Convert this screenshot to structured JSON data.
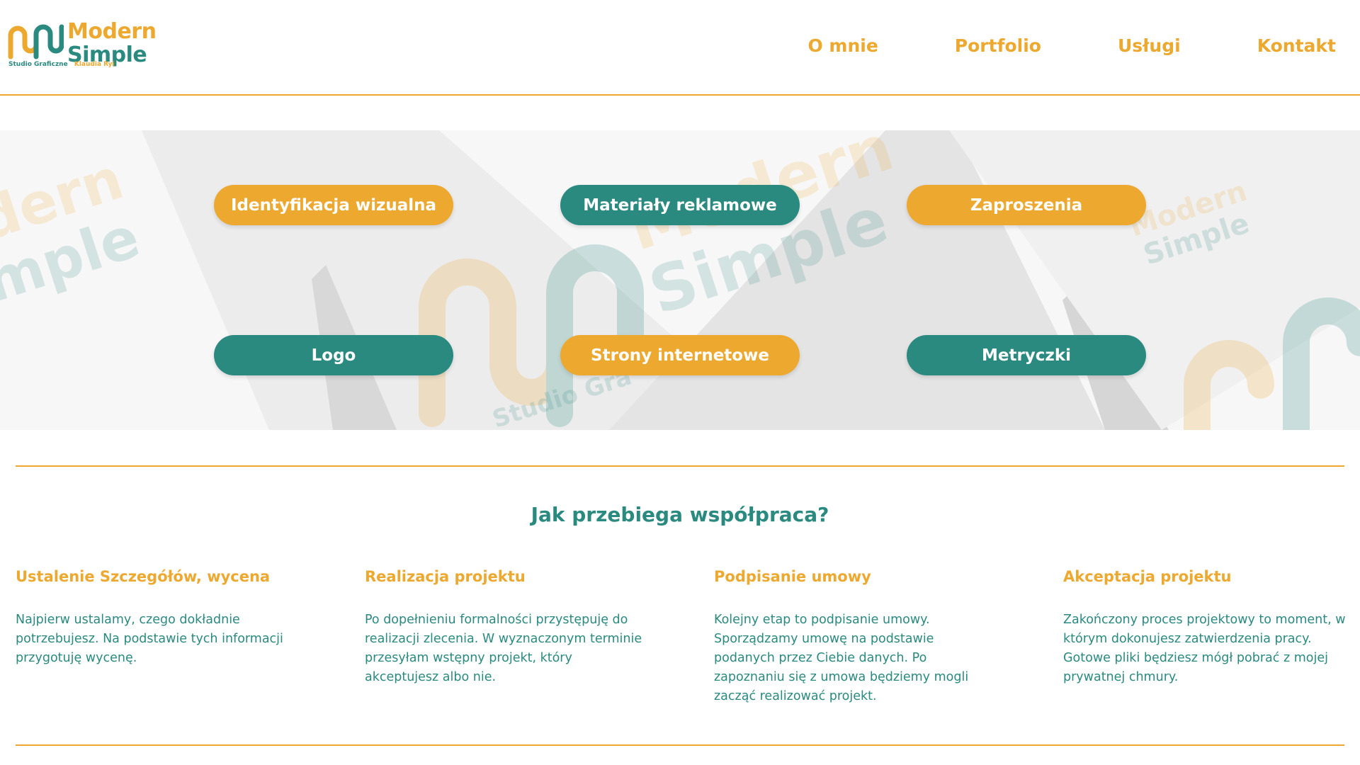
{
  "brand": {
    "name_line1": "Modern",
    "name_line2": "Simple",
    "sub_left": "Studio Graficzne",
    "sub_right": "Klaudia Ryi",
    "orange": "#eca82f",
    "teal": "#2a8a80"
  },
  "nav": {
    "items": [
      {
        "label": "O mnie"
      },
      {
        "label": "Portfolio"
      },
      {
        "label": "Usługi"
      },
      {
        "label": "Kontakt"
      }
    ]
  },
  "services": {
    "items": [
      {
        "label": "Identyfikacja wizualna",
        "color": "orange"
      },
      {
        "label": "Materiały reklamowe",
        "color": "teal"
      },
      {
        "label": "Zaproszenia",
        "color": "orange"
      },
      {
        "label": "Logo",
        "color": "teal"
      },
      {
        "label": "Strony internetowe",
        "color": "orange"
      },
      {
        "label": "Metryczki",
        "color": "teal"
      }
    ]
  },
  "process": {
    "title": "Jak przebiega współpraca?",
    "steps": [
      {
        "title": "Ustalenie Szczegółów, wycena",
        "text": "Najpierw ustalamy, czego dokładnie potrzebujesz. Na podstawie tych informacji przygotuję wycenę."
      },
      {
        "title": "Realizacja projektu",
        "text": "Po dopełnieniu formalności przystępuję do realizacji zlecenia. W wyznaczonym terminie przesyłam wstępny projekt, który akceptujesz albo nie."
      },
      {
        "title": "Podpisanie umowy",
        "text": "Kolejny etap to podpisanie umowy. Sporządzamy umowę na podstawie podanych przez Ciebie danych. Po zapoznaniu się z umowa będziemy mogli zacząć realizować projekt."
      },
      {
        "title": "Akceptacja projektu",
        "text": "Zakończony proces projektowy to moment, w którym dokonujesz zatwierdzenia pracy. Gotowe pliki będziesz mógł pobrać z mojej prywatnej chmury."
      }
    ]
  }
}
